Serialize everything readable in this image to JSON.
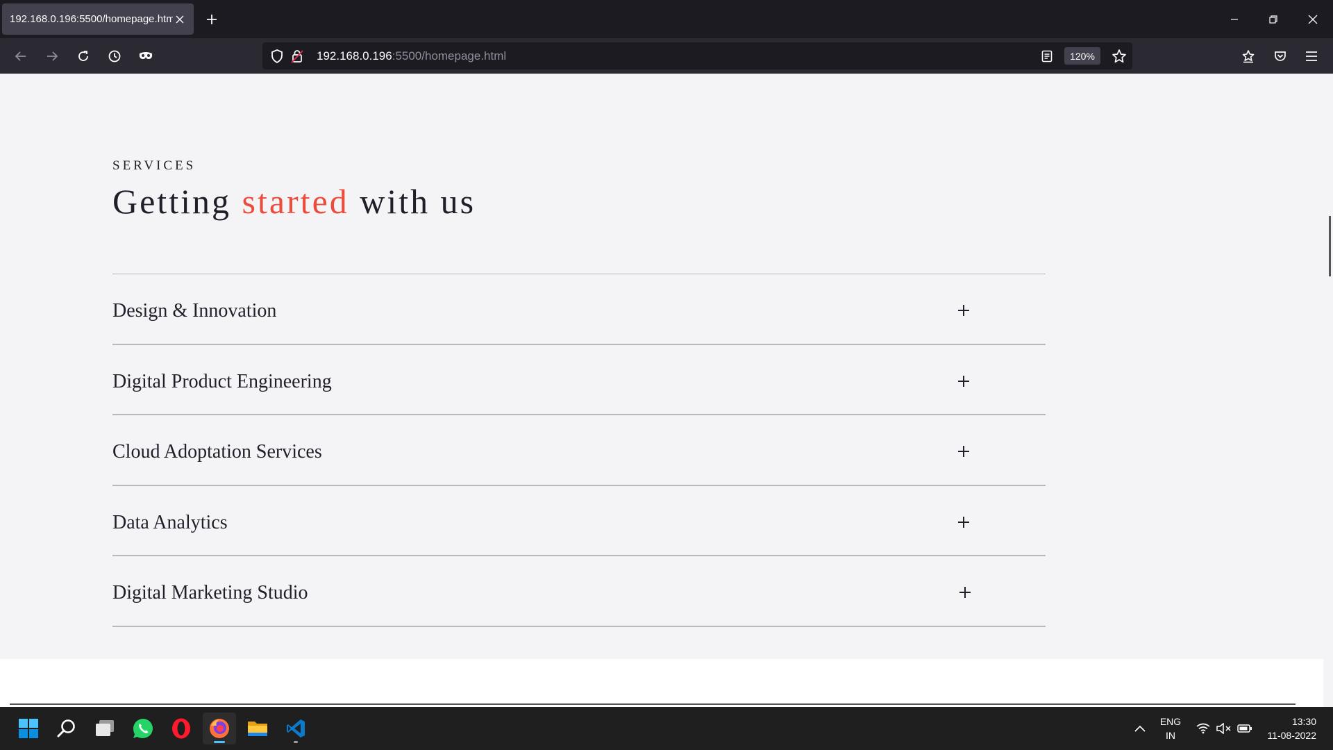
{
  "browser": {
    "tab_title": "192.168.0.196:5500/homepage.html",
    "url_host": "192.168.0.196",
    "url_rest": ":5500/homepage.html",
    "zoom": "120%"
  },
  "page": {
    "eyebrow": "SERVICES",
    "heading_before": "Getting ",
    "heading_accent": "started",
    "heading_after": " with us",
    "accent_color": "#ec4c3c",
    "services": [
      {
        "label": "Design & Innovation",
        "icon": "plus-icon"
      },
      {
        "label": "Digital Product Engineering",
        "icon": "plus-icon"
      },
      {
        "label": "Cloud Adoptation Services",
        "icon": "plus-icon"
      },
      {
        "label": "Data Analytics",
        "icon": "plus-icon"
      },
      {
        "label": "Digital Marketing Studio",
        "icon": "plus-icon"
      }
    ]
  },
  "taskbar": {
    "apps": [
      "start-icon",
      "search-icon",
      "task-view-icon",
      "whatsapp-icon",
      "opera-icon",
      "firefox-icon",
      "file-explorer-icon",
      "vscode-icon"
    ],
    "lang_line1": "ENG",
    "lang_line2": "IN",
    "time": "13:30",
    "date": "11-08-2022"
  }
}
